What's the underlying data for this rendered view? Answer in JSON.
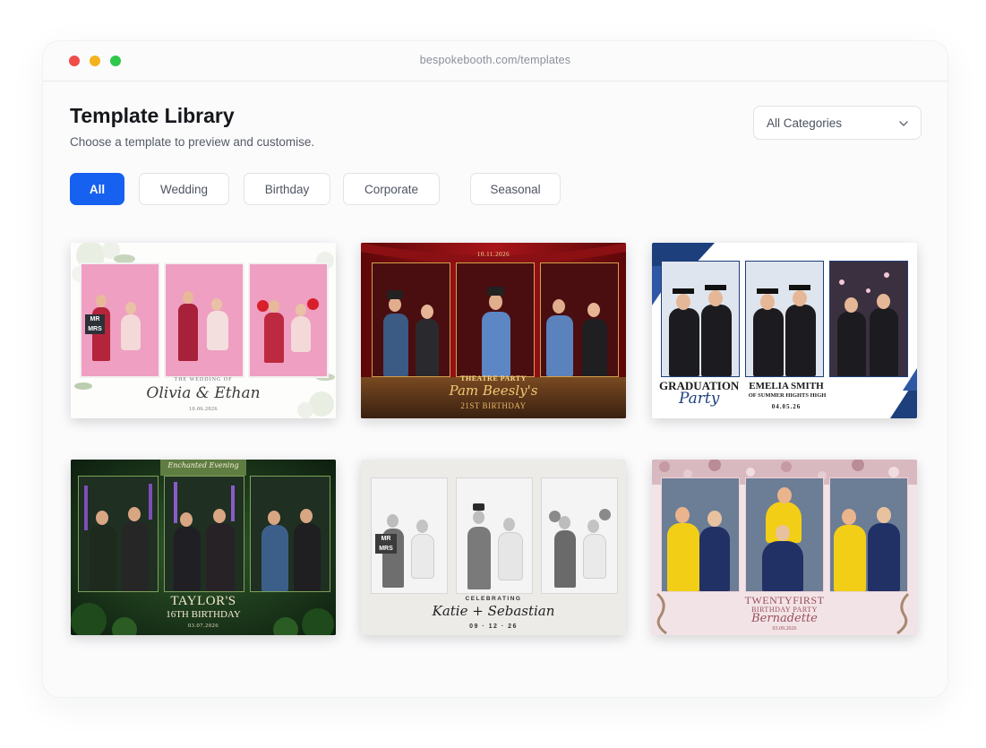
{
  "window": {
    "url": "bespokebooth.com/templates"
  },
  "header": {
    "title": "Template Library",
    "subtitle": "Choose a template to preview and customise."
  },
  "category_select": {
    "value": "All Categories"
  },
  "filters": [
    {
      "label": "All",
      "active": true
    },
    {
      "label": "Wedding",
      "active": false
    },
    {
      "label": "Birthday",
      "active": false
    },
    {
      "label": "Corporate",
      "active": false
    },
    {
      "label": "Seasonal",
      "active": false
    }
  ],
  "templates": [
    {
      "theme": "wedding-floral-pink",
      "line1": "THE WEDDING OF",
      "line2": "Olivia & Ethan",
      "line3": "10.06.2026",
      "prop_sign": "MR MRS"
    },
    {
      "theme": "theatre-red-curtain",
      "top_date": "10.11.2026",
      "line1": "THEATRE PARTY",
      "line2": "Pam Beesly's",
      "line3": "21ST BIRTHDAY"
    },
    {
      "theme": "graduation-navy",
      "line1": "GRADUATION",
      "line2": "Party",
      "line3": "EMELIA SMITH",
      "line4": "OF SUMMER HIGHTS HIGH",
      "line5": "04.05.26"
    },
    {
      "theme": "enchanted-forest-green",
      "top_title": "Enchanted Evening",
      "line1": "TAYLOR'S",
      "line2": "16TH BIRTHDAY",
      "line3": "03.07.2026"
    },
    {
      "theme": "monochrome-wedding",
      "line1": "CELEBRATING",
      "line2": "Katie + Sebastian",
      "line3": "09 · 12 · 26",
      "prop_sign": "MR MRS"
    },
    {
      "theme": "glitter-rose-birthday",
      "line1": "TWENTYFIRST",
      "line2": "BIRTHDAY PARTY",
      "line3": "Bernadette",
      "line4": "03.09.2026"
    }
  ],
  "colors": {
    "accent": "#1761f0",
    "title": "#15171b",
    "muted": "#555b66",
    "border": "#e1e4e8"
  },
  "icons": {
    "chevron": "chevron-down-icon"
  }
}
